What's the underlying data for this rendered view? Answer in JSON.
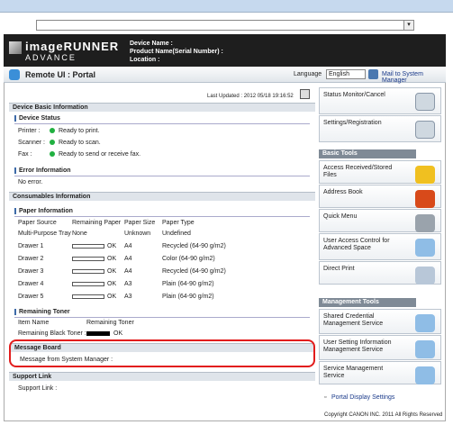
{
  "header": {
    "brand_line1": "imageRUNNER",
    "brand_line2": "ADVANCE",
    "device_name_label": "Device Name :",
    "product_name_label": "Product Name(Serial Number) :",
    "location_label": "Location :",
    "portal_title": "Remote UI : Portal",
    "language_label": "Language",
    "language_value": "English",
    "mail_link": "Mail to System Manager"
  },
  "updated": "Last Updated : 2012 05/18 19:16:52",
  "device_basic": {
    "title": "Device Basic Information",
    "status_title": "Device Status",
    "status_rows": [
      {
        "label": "Printer :",
        "status": "Ready to print."
      },
      {
        "label": "Scanner :",
        "status": "Ready to scan."
      },
      {
        "label": "Fax :",
        "status": "Ready to send or receive fax."
      }
    ],
    "error_title": "Error Information",
    "error_text": "No error."
  },
  "consumables": {
    "title": "Consumables Information",
    "paper_title": "Paper Information",
    "columns": [
      "Paper Source",
      "Remaining Paper",
      "Paper Size",
      "Paper Type"
    ],
    "rows": [
      {
        "source": "Multi-Purpose Tray",
        "remaining": "None",
        "size": "Unknown",
        "type": "Undefined"
      },
      {
        "source": "Drawer 1",
        "remaining": "OK",
        "size": "A4",
        "type": "Recycled (64-90 g/m2)"
      },
      {
        "source": "Drawer 2",
        "remaining": "OK",
        "size": "A4",
        "type": "Color (64-90 g/m2)"
      },
      {
        "source": "Drawer 3",
        "remaining": "OK",
        "size": "A4",
        "type": "Recycled (64-90 g/m2)"
      },
      {
        "source": "Drawer 4",
        "remaining": "OK",
        "size": "A3",
        "type": "Plain (64-90 g/m2)"
      },
      {
        "source": "Drawer 5",
        "remaining": "OK",
        "size": "A3",
        "type": "Plain (64-90 g/m2)"
      }
    ],
    "toner_title": "Remaining Toner",
    "toner_columns": [
      "Item Name",
      "Remaining Toner"
    ],
    "toner_row": {
      "name": "Remaining Black Toner :",
      "status": "OK"
    }
  },
  "message_board": {
    "title": "Message Board",
    "text": "Message from System Manager :"
  },
  "support": {
    "title": "Support Link",
    "text": "Support Link :"
  },
  "right": {
    "status_monitor": "Status Monitor/Cancel",
    "settings": "Settings/Registration",
    "basic_tools_title": "Basic Tools",
    "basic_tools": [
      "Access Received/Stored Files",
      "Address Book",
      "Quick Menu",
      "User Access Control for Advanced Space",
      "Direct Print"
    ],
    "mgmt_title": "Management Tools",
    "mgmt_tools": [
      "Shared Credential Management Service",
      "User Setting Information Management Service",
      "Service Management Service"
    ],
    "portal_display": "Portal Display Settings"
  },
  "footer": "Copyright CANON INC. 2011 All Rights Reserved"
}
